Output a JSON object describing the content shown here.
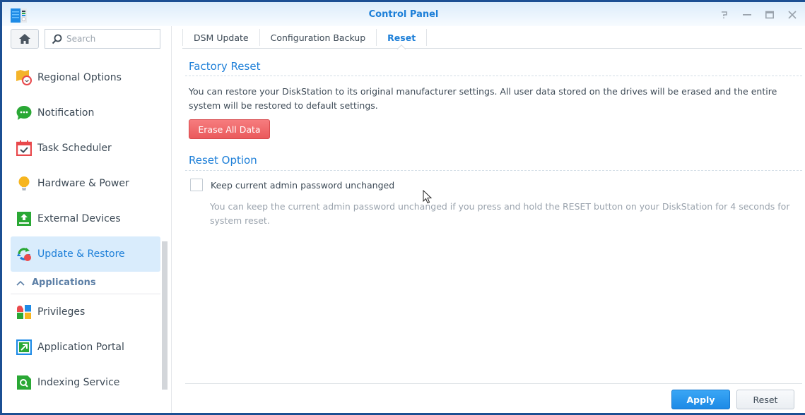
{
  "window": {
    "title": "Control Panel",
    "controls": [
      "help",
      "minimize",
      "maximize",
      "close"
    ]
  },
  "sidebar": {
    "home_icon": "home-icon",
    "search": {
      "placeholder": "Search",
      "value": ""
    },
    "items": [
      {
        "label": "Regional Options",
        "icon": "regional-options-icon"
      },
      {
        "label": "Notification",
        "icon": "notification-icon"
      },
      {
        "label": "Task Scheduler",
        "icon": "task-scheduler-icon"
      },
      {
        "label": "Hardware & Power",
        "icon": "hardware-power-icon"
      },
      {
        "label": "External Devices",
        "icon": "external-devices-icon"
      },
      {
        "label": "Update & Restore",
        "icon": "update-restore-icon",
        "active": true
      }
    ],
    "section": {
      "label": "Applications",
      "expanded": true
    },
    "section_items": [
      {
        "label": "Privileges",
        "icon": "privileges-icon"
      },
      {
        "label": "Application Portal",
        "icon": "application-portal-icon"
      },
      {
        "label": "Indexing Service",
        "icon": "indexing-service-icon"
      }
    ]
  },
  "main": {
    "tabs": [
      {
        "label": "DSM Update"
      },
      {
        "label": "Configuration Backup"
      },
      {
        "label": "Reset",
        "active": true
      }
    ],
    "factory_reset": {
      "title": "Factory Reset",
      "description": "You can restore your DiskStation to its original manufacturer settings. All user data stored on the drives will be erased and the entire system will be restored to default settings.",
      "button": "Erase All Data"
    },
    "reset_option": {
      "title": "Reset Option",
      "checkbox_label": "Keep current admin password unchanged",
      "checked": false,
      "hint": "You can keep the current admin password unchanged if you press and hold the RESET button on your DiskStation for 4 seconds for system reset."
    },
    "footer": {
      "apply": "Apply",
      "reset": "Reset"
    }
  },
  "colors": {
    "accent": "#1d7fd8",
    "danger": "#ea5a5c",
    "active_bg": "#d9ecfc"
  }
}
